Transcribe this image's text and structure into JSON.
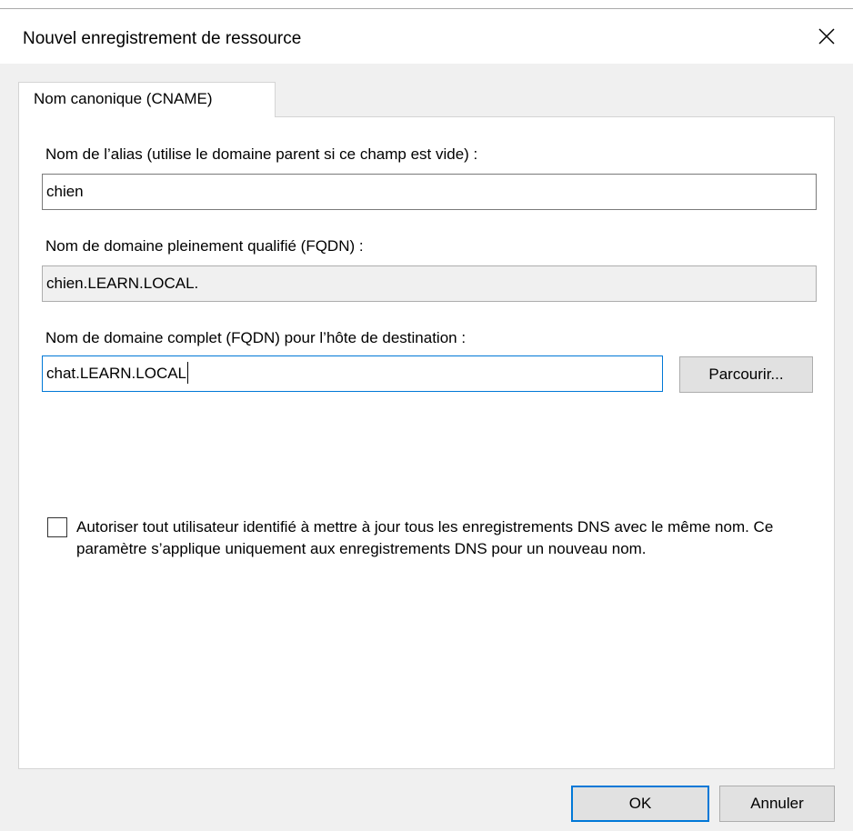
{
  "window": {
    "title": "Nouvel enregistrement de ressource"
  },
  "tabs": [
    {
      "label": "Nom canonique (CNAME)",
      "active": true
    }
  ],
  "form": {
    "alias_label": "Nom de l’alias (utilise le domaine parent si ce champ est vide) :",
    "alias_value": "chien",
    "fqdn_label": "Nom de domaine pleinement qualifié (FQDN) :",
    "fqdn_value": "chien.LEARN.LOCAL.",
    "target_label": "Nom de domaine complet (FQDN) pour l’hôte de destination :",
    "target_value": "chat.LEARN.LOCAL",
    "browse_label": "Parcourir...",
    "allow_update_label": "Autoriser tout utilisateur identifié à mettre à jour tous les enregistrements DNS avec le même nom. Ce paramètre s’applique uniquement aux enregistrements DNS pour un nouveau nom.",
    "allow_update_checked": false
  },
  "buttons": {
    "ok": "OK",
    "cancel": "Annuler"
  },
  "icons": {
    "close": "close-icon"
  },
  "colors": {
    "focus_accent": "#0078d7"
  }
}
